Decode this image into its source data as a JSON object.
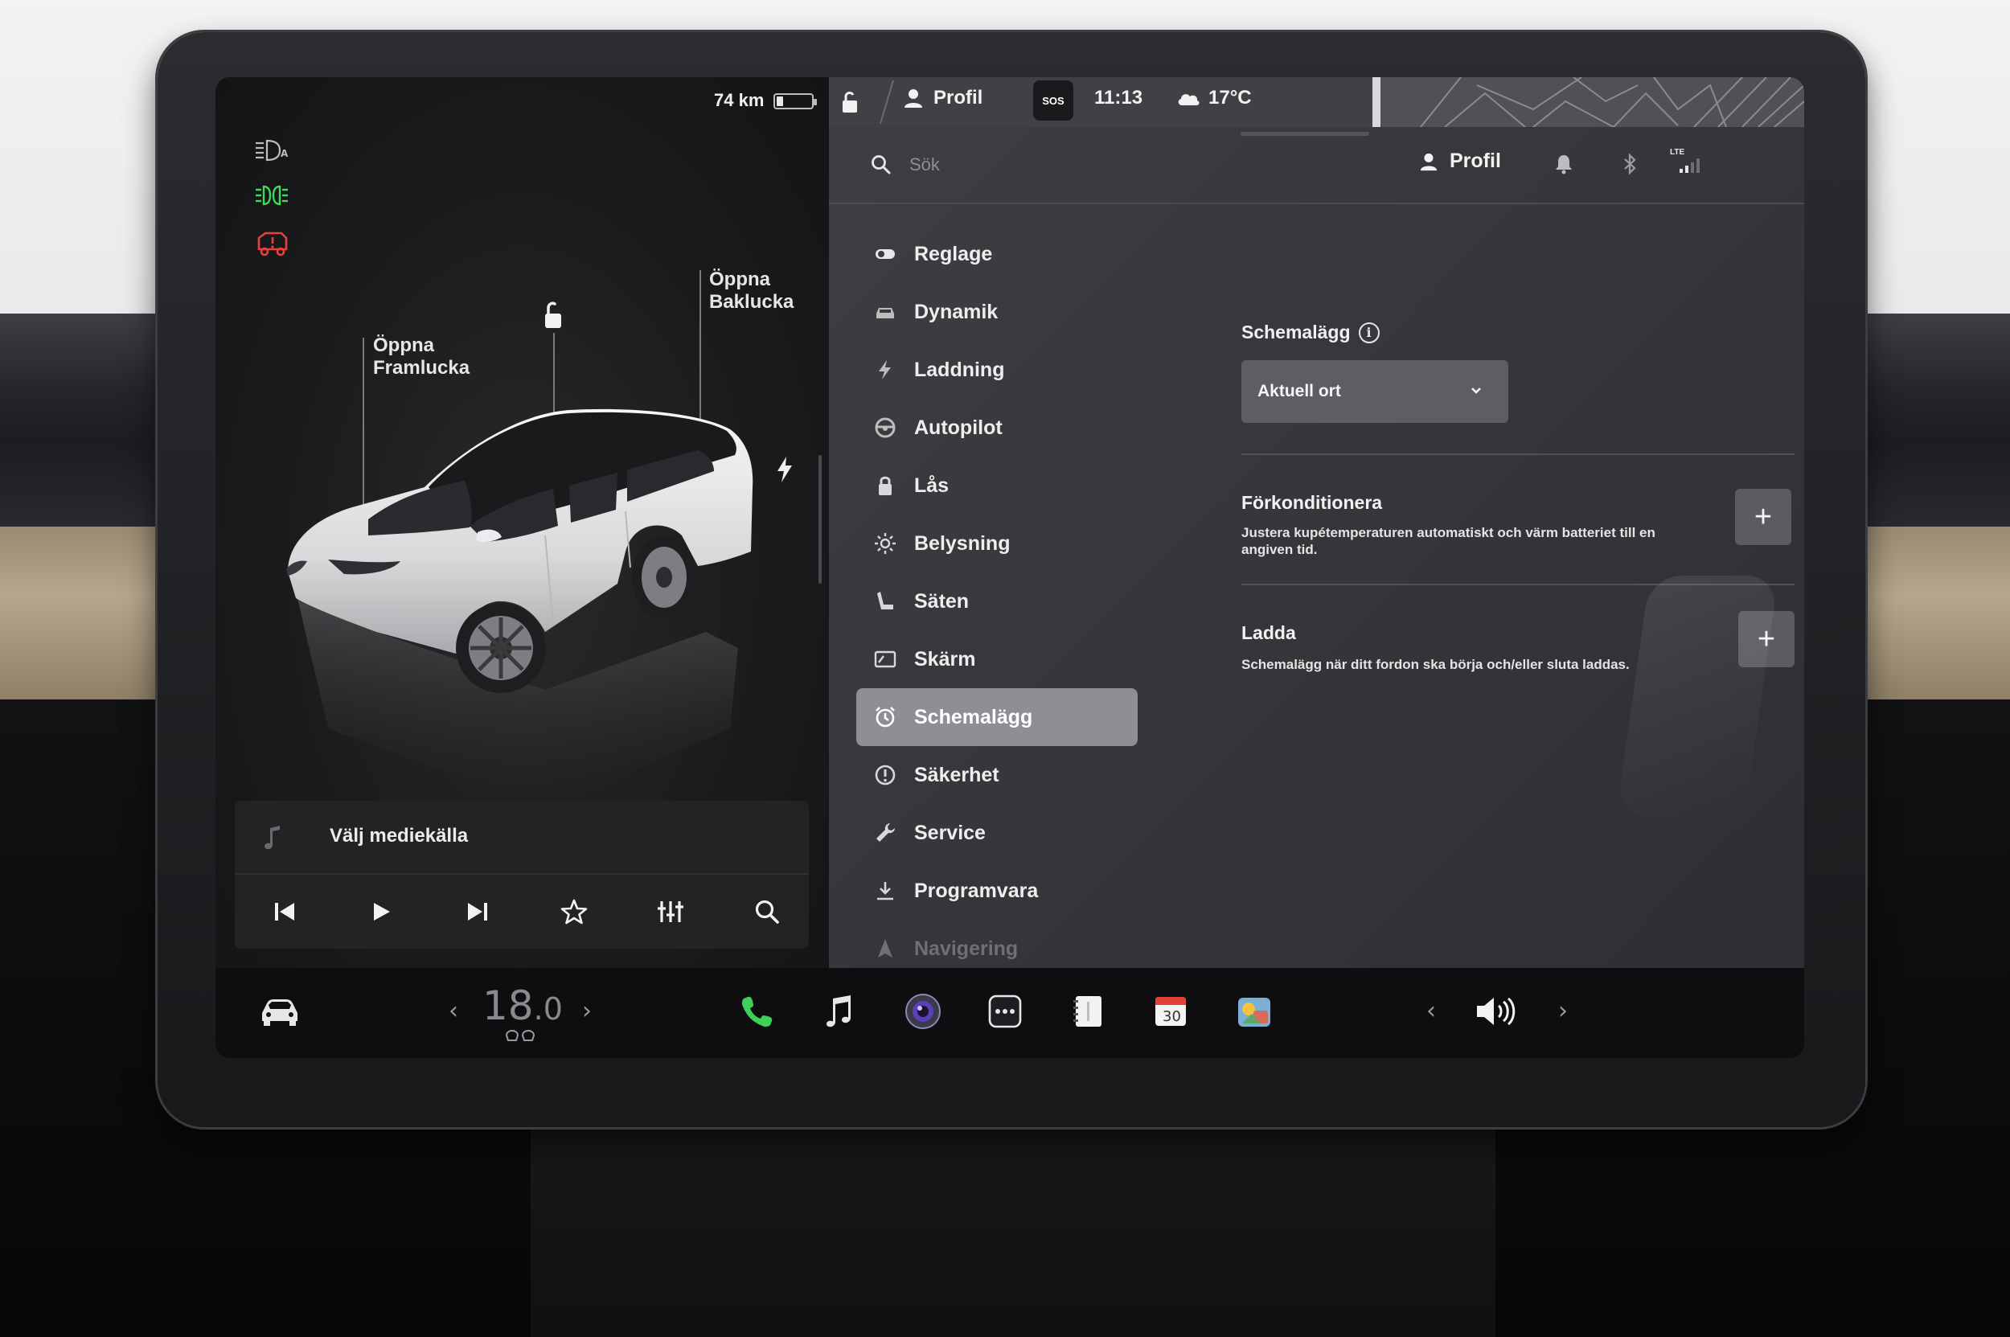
{
  "vehicle": {
    "range": "74 km",
    "battery_level": 0.18,
    "labels": {
      "frunk": [
        "Öppna",
        "Framlucka"
      ],
      "trunk": [
        "Öppna",
        "Baklucka"
      ]
    }
  },
  "media": {
    "source_label": "Välj mediekälla"
  },
  "status_bar": {
    "profile": "Profil",
    "sos": "SOS",
    "time": "11:13",
    "temperature": "17°C"
  },
  "header": {
    "search_placeholder": "Sök",
    "profile": "Profil",
    "network": "LTE"
  },
  "menu": [
    {
      "label": "Reglage",
      "icon": "toggle-icon"
    },
    {
      "label": "Dynamik",
      "icon": "car-icon"
    },
    {
      "label": "Laddning",
      "icon": "bolt-icon"
    },
    {
      "label": "Autopilot",
      "icon": "steering-wheel-icon"
    },
    {
      "label": "Lås",
      "icon": "lock-icon"
    },
    {
      "label": "Belysning",
      "icon": "sun-icon"
    },
    {
      "label": "Säten",
      "icon": "seat-icon"
    },
    {
      "label": "Skärm",
      "icon": "display-icon"
    },
    {
      "label": "Schemalägg",
      "icon": "alarm-clock-icon",
      "active": true
    },
    {
      "label": "Säkerhet",
      "icon": "alert-circle-icon"
    },
    {
      "label": "Service",
      "icon": "wrench-icon"
    },
    {
      "label": "Programvara",
      "icon": "download-icon"
    },
    {
      "label": "Navigering",
      "icon": "navigation-icon"
    }
  ],
  "schedule": {
    "title": "Schemalägg",
    "location_dropdown": "Aktuell ort",
    "preconditioning": {
      "title": "Förkonditionera",
      "description": "Justera kupétemperaturen automatiskt och värm batteriet till en angiven tid."
    },
    "charging": {
      "title": "Ladda",
      "description": "Schemalägg när ditt fordon ska börja och/eller sluta laddas."
    }
  },
  "dock": {
    "temperature_whole": "18",
    "temperature_decimal": ".0",
    "calendar_day": "30"
  },
  "colors": {
    "accent_active": "#8d8f94",
    "phone_green": "#3fcf5a",
    "lights_green": "#3ddc5b",
    "warning_red": "#e8413c"
  }
}
